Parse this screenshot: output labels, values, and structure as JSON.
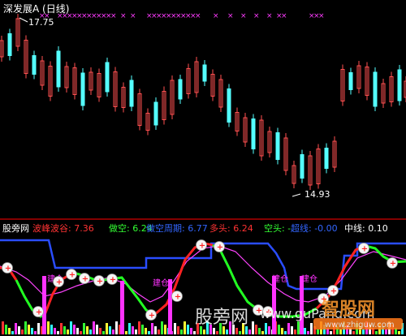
{
  "upper": {
    "title": "深发展A (日线)",
    "high_label": "17.75",
    "low_label": "14.93",
    "colors": {
      "up": "#ff5050",
      "down": "#54ffff",
      "title": "#ffffff",
      "marker": "#ff3cff"
    }
  },
  "lower": {
    "legend": [
      {
        "label": "股旁网",
        "color": "#ffffff"
      },
      {
        "label": "波峰波谷: 7.36",
        "color": "#ff3333"
      },
      {
        "label": "做空: 6.24",
        "color": "#33ff33"
      },
      {
        "label": "做空周期: 6.77",
        "color": "#3366ff"
      },
      {
        "label": "多头: 6.24",
        "color": "#ff3333"
      },
      {
        "label": "空头: -",
        "color": "#33ff33"
      },
      {
        "label": "超线: -0.00",
        "color": "#3366ff"
      },
      {
        "label": "中线: 0.10",
        "color": "#ffffff"
      }
    ],
    "buy_marker_text": "建仓",
    "watermark_cn": "股旁网",
    "watermark_url": "www.guPang.com",
    "watermark_logo": "智股网",
    "watermark_logo_url": "www.zhiguw.com"
  }
}
